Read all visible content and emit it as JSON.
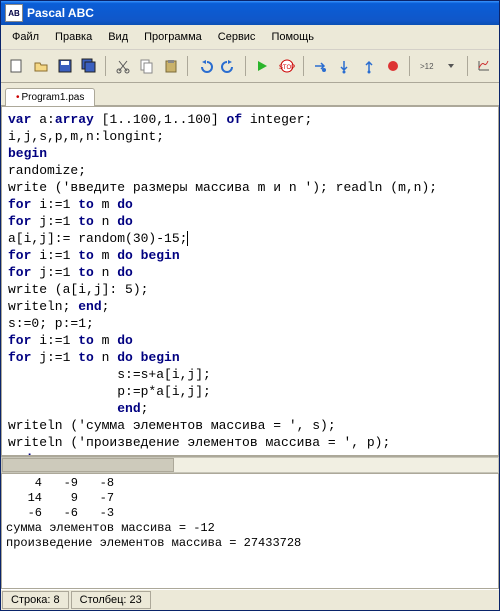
{
  "titlebar": {
    "title": "Pascal ABC",
    "app_icon_text": "AB"
  },
  "menubar": {
    "items": [
      "Файл",
      "Правка",
      "Вид",
      "Программа",
      "Сервис",
      "Помощь"
    ]
  },
  "toolbar": {
    "icons": [
      "new",
      "open",
      "save",
      "saveall",
      "cut",
      "copy",
      "paste",
      "undo",
      "redo",
      "run",
      "stop",
      "stepover",
      "stepinto",
      "stepout",
      "breakpoint",
      "watch",
      "calc",
      "plot"
    ]
  },
  "tabs": {
    "items": [
      {
        "modified": true,
        "label": "Program1.pas"
      }
    ]
  },
  "code": {
    "lines": [
      {
        "t": "kw",
        "s": "var "
      },
      {
        "t": "",
        "s": "a:"
      },
      {
        "t": "kw",
        "s": "array"
      },
      {
        "t": "",
        "s": " [1..100,1..100] "
      },
      {
        "t": "kw",
        "s": "of"
      },
      {
        "t": "",
        "s": " integer;"
      },
      {
        "t": "br"
      },
      {
        "t": "",
        "s": "i,j,s,p,m,n:longint;"
      },
      {
        "t": "br"
      },
      {
        "t": "kw",
        "s": "begin"
      },
      {
        "t": "br"
      },
      {
        "t": "",
        "s": "randomize;"
      },
      {
        "t": "br"
      },
      {
        "t": "",
        "s": "write ('введите размеры массива m и n '); readln (m,n);"
      },
      {
        "t": "br"
      },
      {
        "t": "kw",
        "s": "for"
      },
      {
        "t": "",
        "s": " i:=1 "
      },
      {
        "t": "kw",
        "s": "to"
      },
      {
        "t": "",
        "s": " m "
      },
      {
        "t": "kw",
        "s": "do"
      },
      {
        "t": "br"
      },
      {
        "t": "kw",
        "s": "for"
      },
      {
        "t": "",
        "s": " j:=1 "
      },
      {
        "t": "kw",
        "s": "to"
      },
      {
        "t": "",
        "s": " n "
      },
      {
        "t": "kw",
        "s": "do"
      },
      {
        "t": "br"
      },
      {
        "t": "",
        "s": "a[i,j]:= random(30)-15"
      },
      {
        "t": "cur",
        "s": ";"
      },
      {
        "t": "br"
      },
      {
        "t": "kw",
        "s": "for"
      },
      {
        "t": "",
        "s": " i:=1 "
      },
      {
        "t": "kw",
        "s": "to"
      },
      {
        "t": "",
        "s": " m "
      },
      {
        "t": "kw",
        "s": "do begin"
      },
      {
        "t": "br"
      },
      {
        "t": "kw",
        "s": "for"
      },
      {
        "t": "",
        "s": " j:=1 "
      },
      {
        "t": "kw",
        "s": "to"
      },
      {
        "t": "",
        "s": " n "
      },
      {
        "t": "kw",
        "s": "do"
      },
      {
        "t": "br"
      },
      {
        "t": "",
        "s": "write (a[i,j]: 5);"
      },
      {
        "t": "br"
      },
      {
        "t": "",
        "s": "writeln; "
      },
      {
        "t": "kw",
        "s": "end"
      },
      {
        "t": "",
        "s": ";"
      },
      {
        "t": "br"
      },
      {
        "t": "",
        "s": "s:=0; p:=1;"
      },
      {
        "t": "br"
      },
      {
        "t": "kw",
        "s": "for"
      },
      {
        "t": "",
        "s": " i:=1 "
      },
      {
        "t": "kw",
        "s": "to"
      },
      {
        "t": "",
        "s": " m "
      },
      {
        "t": "kw",
        "s": "do"
      },
      {
        "t": "br"
      },
      {
        "t": "kw",
        "s": "for"
      },
      {
        "t": "",
        "s": " j:=1 "
      },
      {
        "t": "kw",
        "s": "to"
      },
      {
        "t": "",
        "s": " n "
      },
      {
        "t": "kw",
        "s": "do begin"
      },
      {
        "t": "br"
      },
      {
        "t": "",
        "s": "              s:=s+a[i,j];"
      },
      {
        "t": "br"
      },
      {
        "t": "",
        "s": "              p:=p*a[i,j];"
      },
      {
        "t": "br"
      },
      {
        "t": "",
        "s": "              "
      },
      {
        "t": "kw",
        "s": "end"
      },
      {
        "t": "",
        "s": ";"
      },
      {
        "t": "br"
      },
      {
        "t": "",
        "s": "writeln ('сумма элементов массива = ', s);"
      },
      {
        "t": "br"
      },
      {
        "t": "",
        "s": "writeln ('произведение элементов массива = ', p);"
      },
      {
        "t": "br"
      },
      {
        "t": "kw",
        "s": "end"
      }
    ]
  },
  "output": {
    "lines": [
      "    4   -9   -8",
      "   14    9   -7",
      "   -6   -6   -3",
      "сумма элементов массива = -12",
      "произведение элементов массива = 27433728",
      ""
    ]
  },
  "statusbar": {
    "line_label": "Строка: 8",
    "col_label": "Столбец: 23"
  }
}
